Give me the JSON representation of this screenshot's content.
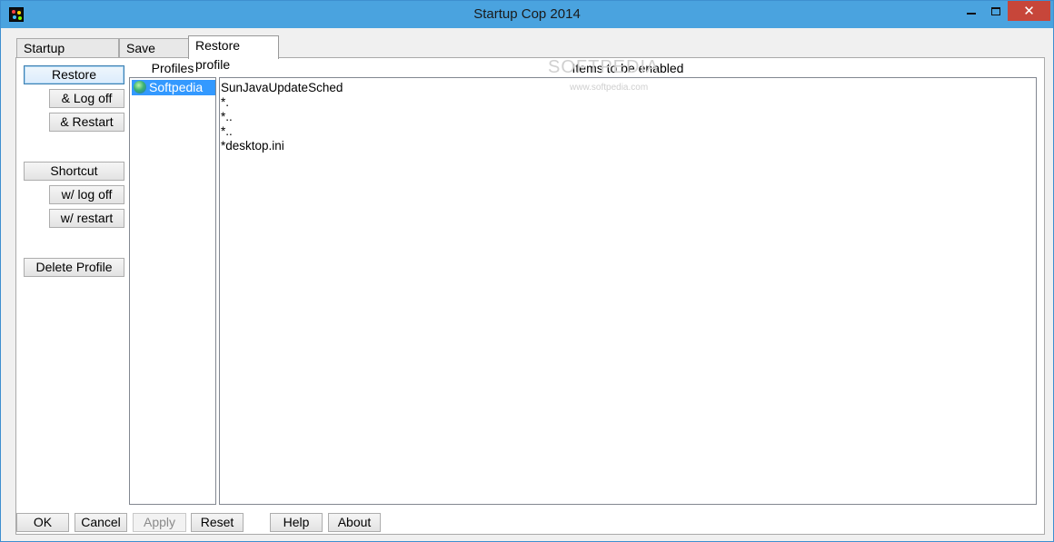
{
  "window": {
    "title": "Startup Cop 2014",
    "close_glyph": "✕"
  },
  "tabs": [
    {
      "label": "Startup programs"
    },
    {
      "label": "Save profile"
    },
    {
      "label": "Restore profile"
    }
  ],
  "left_buttons": {
    "restore": "Restore",
    "log_off": "& Log off",
    "restart": "& Restart",
    "shortcut": "Shortcut",
    "w_log_off": "w/ log off",
    "w_restart": "w/ restart",
    "delete_profile": "Delete Profile"
  },
  "profiles": {
    "header": "Profiles",
    "items": [
      "Softpedia"
    ]
  },
  "items_panel": {
    "header": "Items to be enabled",
    "items": [
      "SunJavaUpdateSched",
      "*.",
      "*..",
      "*..",
      "*desktop.ini"
    ]
  },
  "watermark": {
    "main": "SOFTPEDIA",
    "url": "www.softpedia.com"
  },
  "bottom_buttons": {
    "ok": "OK",
    "cancel": "Cancel",
    "apply": "Apply",
    "reset": "Reset",
    "help": "Help",
    "about": "About"
  },
  "colors": {
    "titlebar": "#4aa3df",
    "close_button": "#c7463a",
    "selection": "#3399ff"
  }
}
